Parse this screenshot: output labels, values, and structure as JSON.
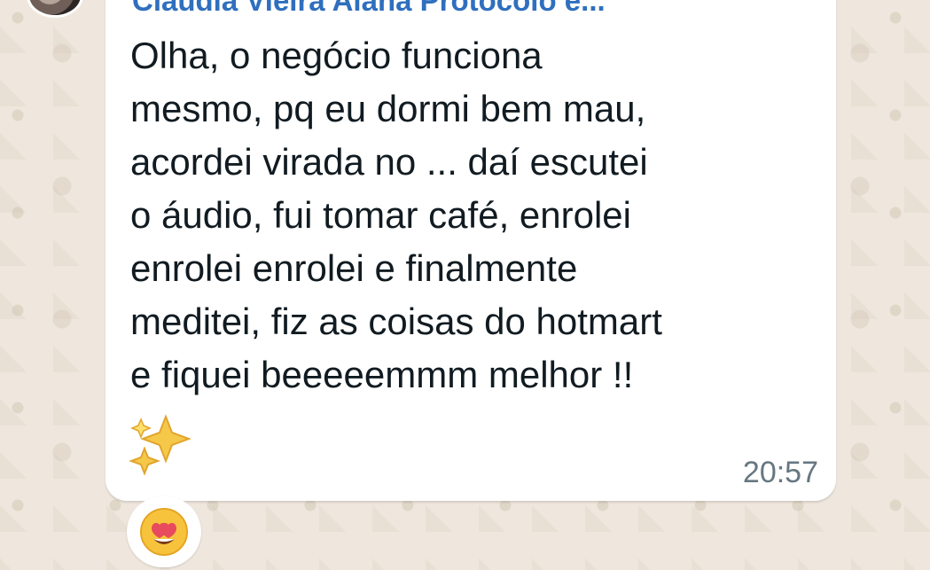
{
  "colors": {
    "chat_background": "#efe7dd",
    "bubble_background": "#ffffff",
    "sender_name": "#2f6fbe",
    "message_text": "#111b21",
    "timestamp": "#667781"
  },
  "message": {
    "sender_name": "Claudia Vieira Aiana Protocolo e...",
    "text": "Olha, o negócio funciona\nmesmo, pq eu dormi bem mau,\nacordei virada no ... daí escutei\no áudio, fui tomar café, enrolei\nenrolei enrolei e finalmente\nmeditei, fiz as coisas do hotmart\ne fiquei beeeeemmm melhor !!",
    "emoji_icon": "sparkles-icon",
    "time": "20:57"
  },
  "reaction": {
    "icon": "heart-eyes-emoji-icon"
  }
}
